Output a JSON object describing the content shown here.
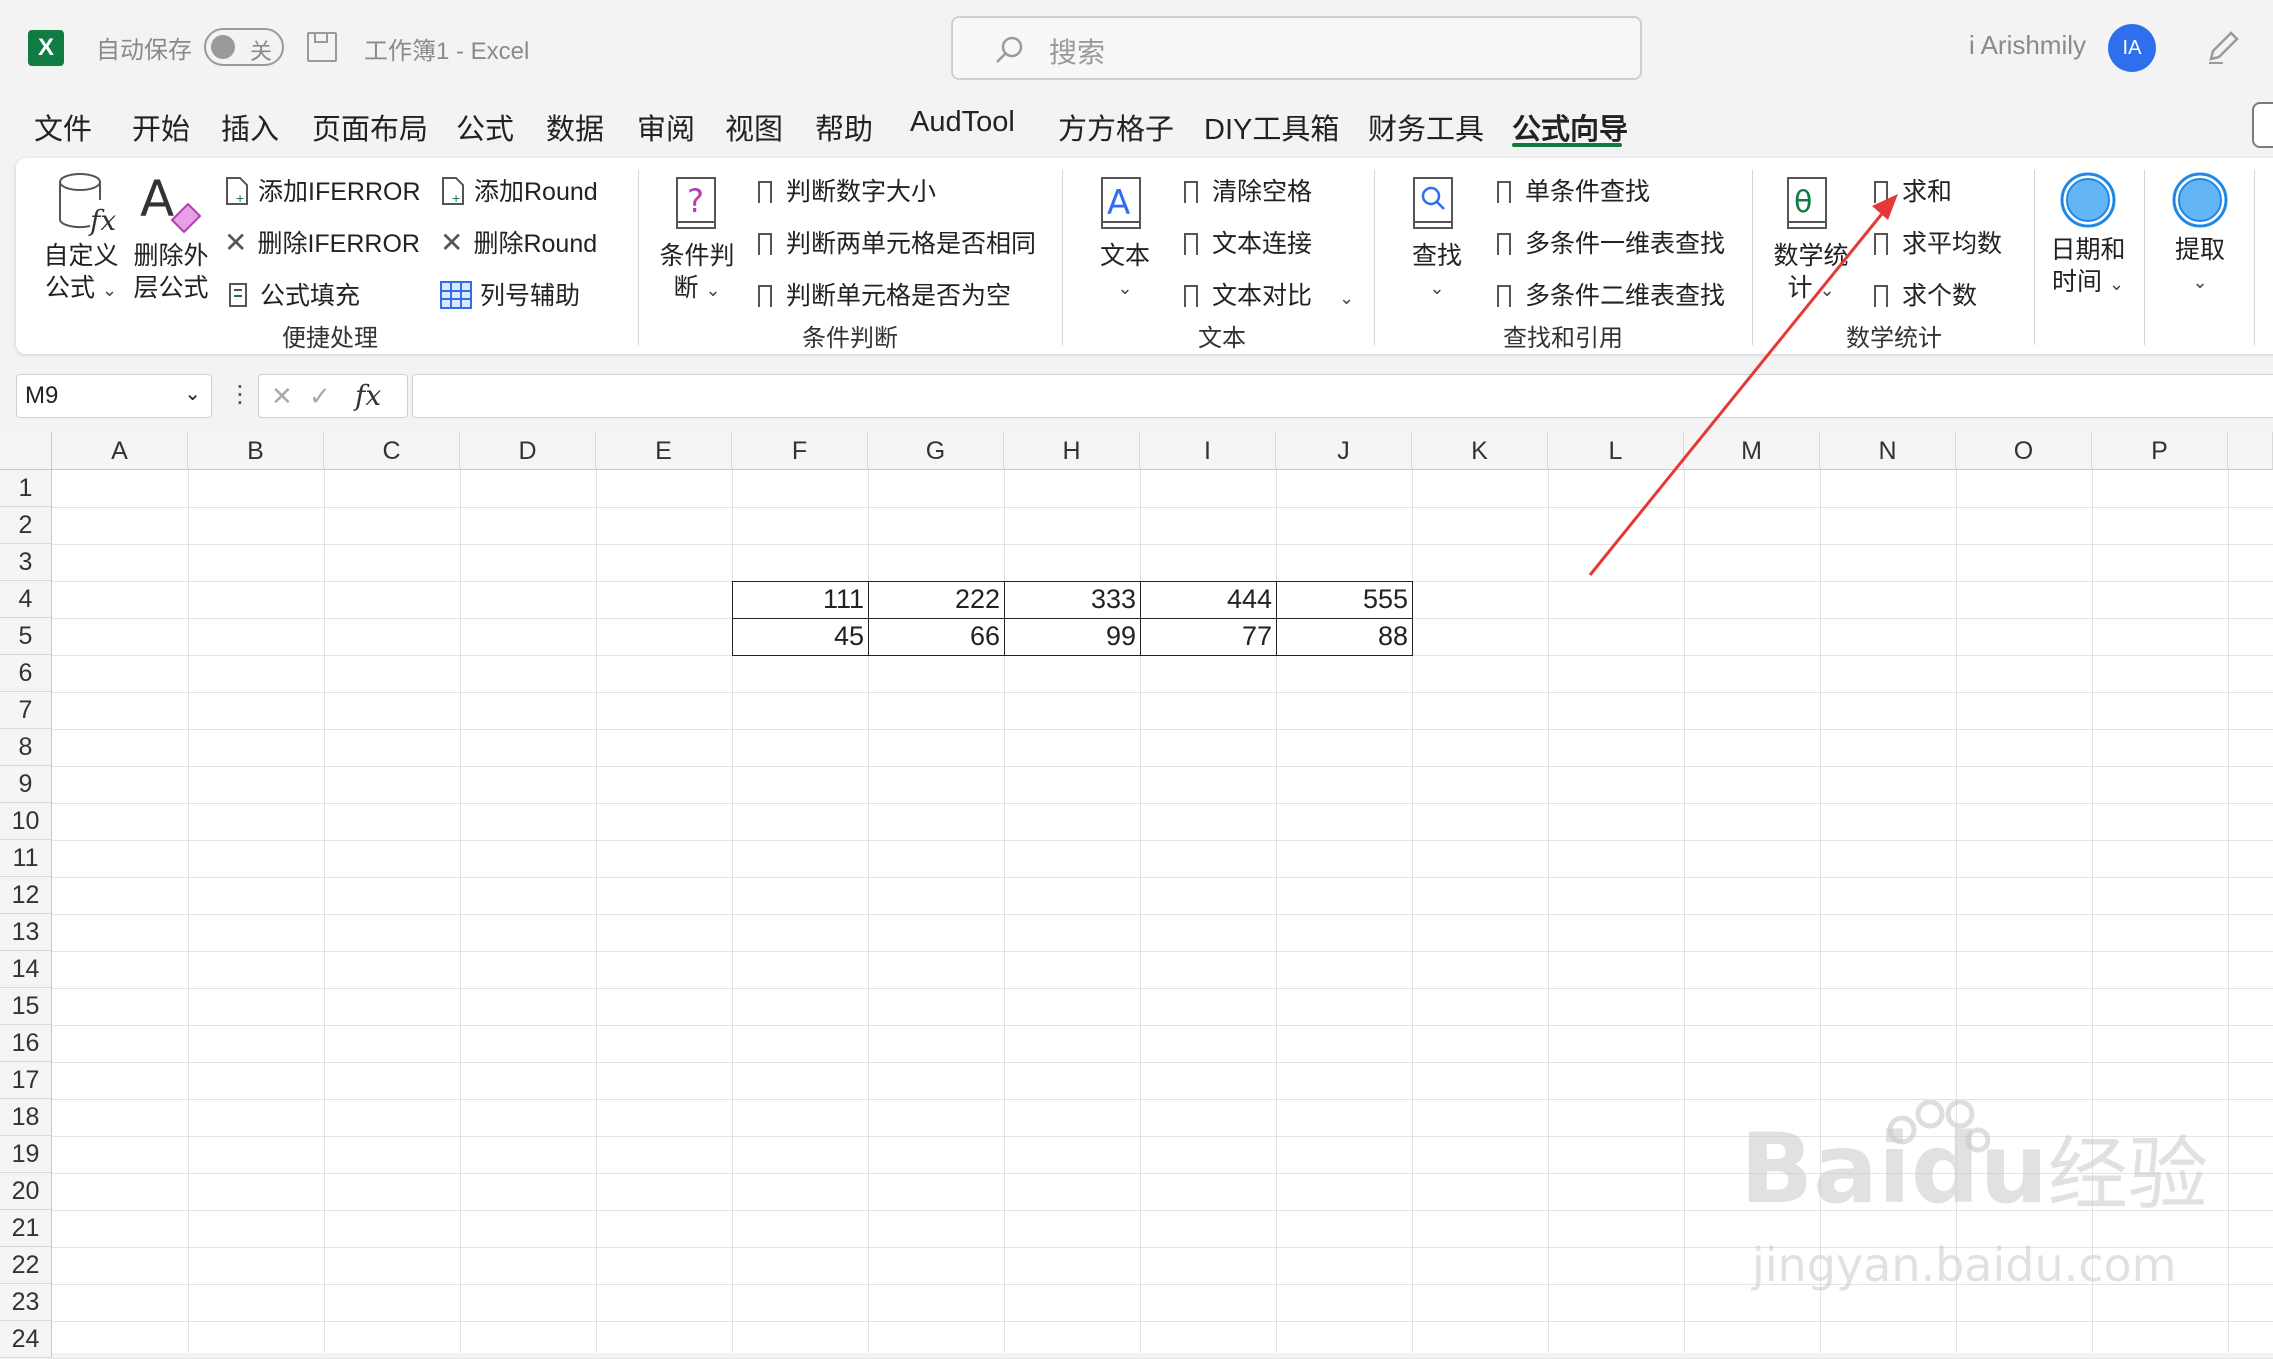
{
  "titlebar": {
    "autosave_label": "自动保存",
    "autosave_state": "关",
    "doc_title": "工作簿1  -  Excel",
    "search_placeholder": "搜索",
    "user_name": "i Arishmily",
    "user_initials": "IA"
  },
  "menu_tabs": [
    "文件",
    "开始",
    "插入",
    "页面布局",
    "公式",
    "数据",
    "审阅",
    "视图",
    "帮助",
    "AudTool",
    "方方格子",
    "DIY工具箱",
    "财务工具",
    "公式向导"
  ],
  "active_tab": "公式向导",
  "ribbon": {
    "groups": [
      {
        "label": "便捷处理",
        "big": [
          {
            "label1": "自定义",
            "label2": "公式"
          },
          {
            "label1": "删除外",
            "label2": "层公式"
          }
        ],
        "small": [
          "添加IFERROR",
          "删除IFERROR",
          "公式填充",
          "添加Round",
          "删除Round",
          "列号辅助"
        ]
      },
      {
        "label": "条件判断",
        "big": [
          {
            "label1": "条件判",
            "label2": "断"
          }
        ],
        "small": [
          "判断数字大小",
          "判断两单元格是否相同",
          "判断单元格是否为空"
        ]
      },
      {
        "label": "文本",
        "big": [
          {
            "label1": "文本"
          }
        ],
        "small": [
          "清除空格",
          "文本连接",
          "文本对比"
        ]
      },
      {
        "label": "查找和引用",
        "big": [
          {
            "label1": "查找"
          }
        ],
        "small": [
          "单条件查找",
          "多条件一维表查找",
          "多条件二维表查找"
        ]
      },
      {
        "label": "数学统计",
        "big": [
          {
            "label1": "数学统",
            "label2": "计"
          }
        ],
        "small": [
          "求和",
          "求平均数",
          "求个数"
        ]
      },
      {
        "label": "",
        "big": [
          {
            "label1": "日期和",
            "label2": "时间"
          }
        ]
      },
      {
        "label": "",
        "big": [
          {
            "label1": "提取"
          }
        ]
      }
    ]
  },
  "formula_bar": {
    "name_box": "M9",
    "fx_label": "fx",
    "formula": ""
  },
  "columns": [
    "A",
    "B",
    "C",
    "D",
    "E",
    "F",
    "G",
    "H",
    "I",
    "J",
    "K",
    "L",
    "M",
    "N",
    "O",
    "P"
  ],
  "rows": [
    "1",
    "2",
    "3",
    "4",
    "5",
    "6",
    "7",
    "8",
    "9",
    "10",
    "11",
    "12",
    "13",
    "14",
    "15",
    "16",
    "17",
    "18",
    "19",
    "20",
    "21",
    "22",
    "23",
    "24"
  ],
  "table": {
    "row4": [
      "111",
      "222",
      "333",
      "444",
      "555"
    ],
    "row5": [
      "45",
      "66",
      "99",
      "77",
      "88"
    ]
  },
  "colors": {
    "excel_green": "#107c41",
    "avatar_blue": "#2f6fed",
    "arrow_red": "#e53935"
  },
  "watermark": {
    "line1_a": "Bai",
    "line1_b": "du",
    "line1_c": "经验",
    "line2": "jingyan.baidu.com"
  }
}
